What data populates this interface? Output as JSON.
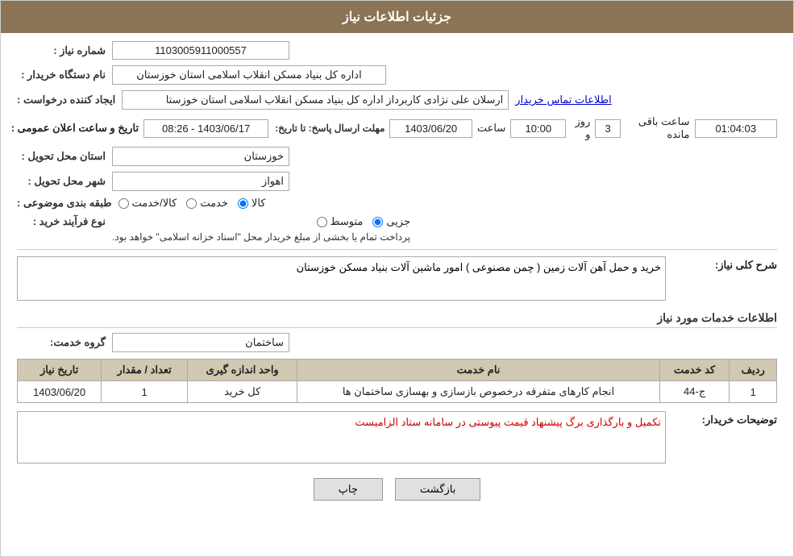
{
  "header": {
    "title": "جزئیات اطلاعات نیاز"
  },
  "fields": {
    "need_number_label": "شماره نیاز :",
    "need_number_value": "1103005911000557",
    "buyer_org_label": "نام دستگاه خریدار :",
    "buyer_org_value": "اداره کل بنیاد مسکن انقلاب اسلامی استان خوزستان",
    "created_by_label": "ایجاد کننده درخواست :",
    "created_by_value": "ارسلان علی نژادی کاربرداز اداره کل بنیاد مسکن انقلاب اسلامی استان خوزستا",
    "contact_link": "اطلاعات تماس خریدار",
    "deadline_label": "مهلت ارسال پاسخ: تا تاریخ:",
    "deadline_date": "1403/06/20",
    "deadline_time_label": "ساعت",
    "deadline_time": "10:00",
    "deadline_days_label": "روز و",
    "deadline_days": "3",
    "deadline_remaining_label": "ساعت باقی مانده",
    "deadline_remaining": "01:04:03",
    "announce_label": "تاریخ و ساعت اعلان عمومی :",
    "announce_value": "1403/06/17 - 08:26",
    "province_label": "استان محل تحویل :",
    "province_value": "خوزستان",
    "city_label": "شهر محل تحویل :",
    "city_value": "اهواز",
    "category_label": "طبقه بندی موضوعی :",
    "category_kala": "کالا",
    "category_khadamat": "خدمت",
    "category_kala_khadamat": "کالا/خدمت",
    "process_label": "نوع فرآیند خرید :",
    "process_jozvi": "جزیی",
    "process_motavasset": "متوسط",
    "process_note": "پرداخت تمام یا بخشی از مبلغ خریدار محل \"اسناد خزانه اسلامی\" خواهد بود.",
    "need_desc_label": "شرح کلی نیاز:",
    "need_desc_value": "خرید و حمل آهن آلات زمین ( چمن مصنوعی ) امور ماشین آلات بنیاد مسکن خوزستان",
    "services_label": "اطلاعات خدمات مورد نیاز",
    "service_group_label": "گروه خدمت:",
    "service_group_value": "ساختمان",
    "table": {
      "headers": [
        "ردیف",
        "کد خدمت",
        "نام خدمت",
        "واحد اندازه گیری",
        "تعداد / مقدار",
        "تاریخ نیاز"
      ],
      "rows": [
        {
          "row": "1",
          "code": "ج-44",
          "name": "انجام کارهای متفرقه درخصوص بازسازی و بهسازی ساختمان ها",
          "unit": "کل خرید",
          "count": "1",
          "date": "1403/06/20"
        }
      ]
    },
    "buyer_notes_label": "توضیحات خریدار:",
    "buyer_notes_value": "تکمیل و بارگذاری برگ پیشنهاد قیمت پیوستی در سامانه ستاد الزامیست"
  },
  "buttons": {
    "print_label": "چاپ",
    "back_label": "بازگشت"
  }
}
